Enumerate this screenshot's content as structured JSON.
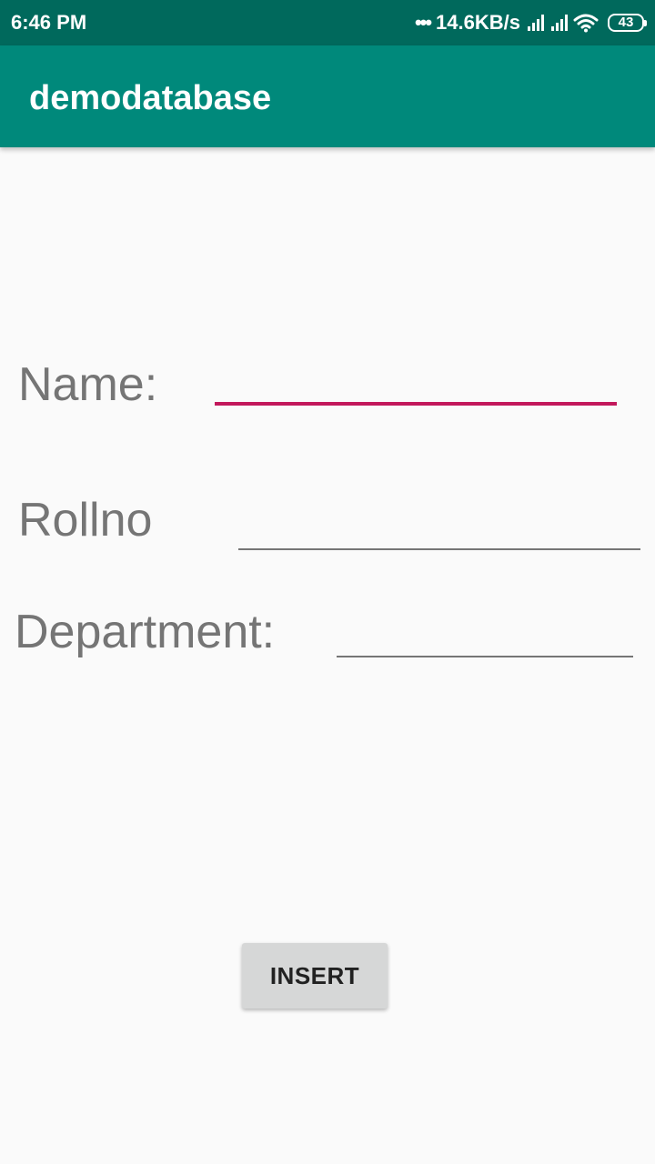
{
  "status_bar": {
    "time": "6:46 PM",
    "dots": "•••",
    "network_speed": "14.6KB/s",
    "battery_level": "43",
    "icons": [
      "signal-icon",
      "signal-icon",
      "wifi-icon",
      "battery-icon"
    ]
  },
  "app_bar": {
    "title": "demodatabase"
  },
  "form": {
    "name_label": "Name:",
    "name_value": "",
    "rollno_label": "Rollno",
    "rollno_value": "",
    "department_label": "Department:",
    "department_value": "",
    "insert_label": "INSERT"
  },
  "colors": {
    "status_bar": "#00695c",
    "app_bar": "#00897b",
    "focused_underline": "#c2185b",
    "underline": "#757575",
    "label_text": "#757575",
    "button_bg": "#d6d7d7",
    "background": "#fafafa"
  }
}
